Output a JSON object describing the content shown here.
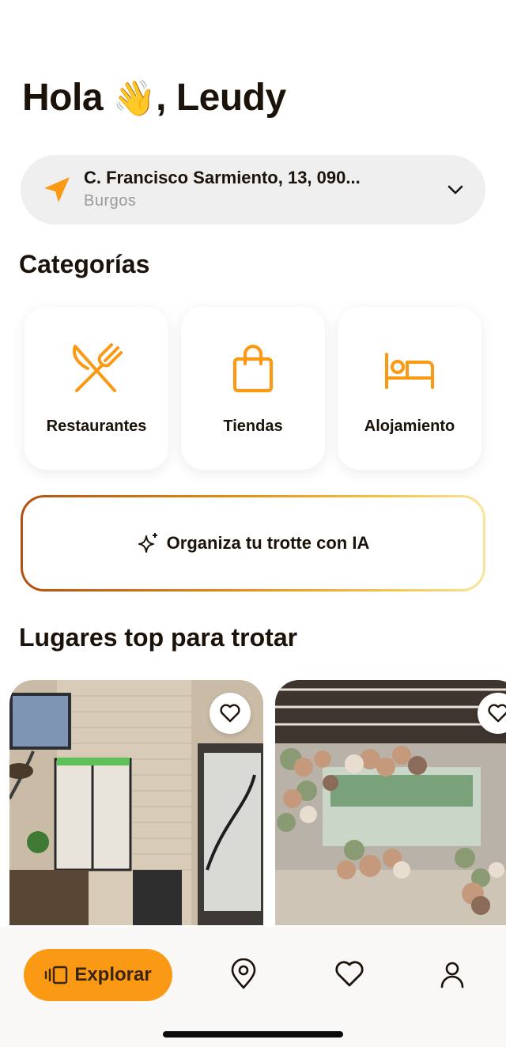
{
  "greeting": {
    "hello": "Hola",
    "wave": "👋",
    "name": ", Leudy"
  },
  "location": {
    "street": "C. Francisco Sarmiento, 13, 090...",
    "city": "Burgos"
  },
  "categories": {
    "title": "Categorías",
    "items": [
      {
        "label": "Restaurantes",
        "icon": "fork-knife-icon"
      },
      {
        "label": "Tiendas",
        "icon": "shopping-bag-icon"
      },
      {
        "label": "Alojamiento",
        "icon": "bed-icon"
      }
    ]
  },
  "ia_button": {
    "label": "Organiza tu trotte con IA",
    "icon": "sparkles-icon"
  },
  "top_places": {
    "title": "Lugares top para trotar"
  },
  "bottom_nav": {
    "explore_label": "Explorar",
    "icons": [
      "cards-icon",
      "map-pin-icon",
      "heart-icon",
      "user-icon"
    ]
  },
  "colors": {
    "accent": "#fa9a14",
    "text": "#1b1309",
    "muted": "#9a9a9a",
    "pill_bg": "#efefef"
  }
}
